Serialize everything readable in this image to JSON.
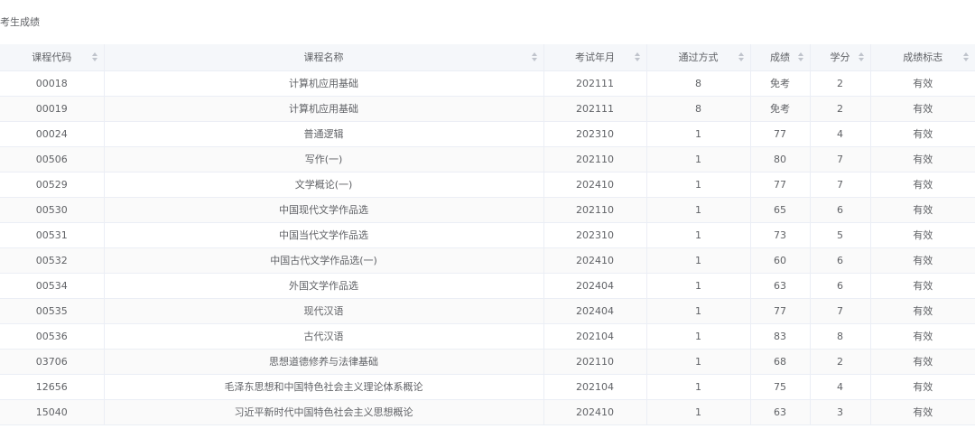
{
  "page": {
    "title": "考生成绩"
  },
  "table": {
    "columns": [
      {
        "key": "code",
        "label": "课程代码"
      },
      {
        "key": "name",
        "label": "课程名称"
      },
      {
        "key": "exam_date",
        "label": "考试年月"
      },
      {
        "key": "method",
        "label": "通过方式"
      },
      {
        "key": "score",
        "label": "成绩"
      },
      {
        "key": "credit",
        "label": "学分"
      },
      {
        "key": "flag",
        "label": "成绩标志"
      }
    ],
    "rows": [
      [
        "00018",
        "计算机应用基础",
        "202111",
        "8",
        "免考",
        "2",
        "有效"
      ],
      [
        "00019",
        "计算机应用基础",
        "202111",
        "8",
        "免考",
        "2",
        "有效"
      ],
      [
        "00024",
        "普通逻辑",
        "202310",
        "1",
        "77",
        "4",
        "有效"
      ],
      [
        "00506",
        "写作(一)",
        "202110",
        "1",
        "80",
        "7",
        "有效"
      ],
      [
        "00529",
        "文学概论(一)",
        "202410",
        "1",
        "77",
        "7",
        "有效"
      ],
      [
        "00530",
        "中国现代文学作品选",
        "202110",
        "1",
        "65",
        "6",
        "有效"
      ],
      [
        "00531",
        "中国当代文学作品选",
        "202310",
        "1",
        "73",
        "5",
        "有效"
      ],
      [
        "00532",
        "中国古代文学作品选(一)",
        "202410",
        "1",
        "60",
        "6",
        "有效"
      ],
      [
        "00534",
        "外国文学作品选",
        "202404",
        "1",
        "63",
        "6",
        "有效"
      ],
      [
        "00535",
        "现代汉语",
        "202404",
        "1",
        "77",
        "7",
        "有效"
      ],
      [
        "00536",
        "古代汉语",
        "202104",
        "1",
        "83",
        "8",
        "有效"
      ],
      [
        "03706",
        "思想道德修养与法律基础",
        "202110",
        "1",
        "68",
        "2",
        "有效"
      ],
      [
        "12656",
        "毛泽东思想和中国特色社会主义理论体系概论",
        "202104",
        "1",
        "75",
        "4",
        "有效"
      ],
      [
        "15040",
        "习近平新时代中国特色社会主义思想概论",
        "202410",
        "1",
        "63",
        "3",
        "有效"
      ]
    ]
  }
}
